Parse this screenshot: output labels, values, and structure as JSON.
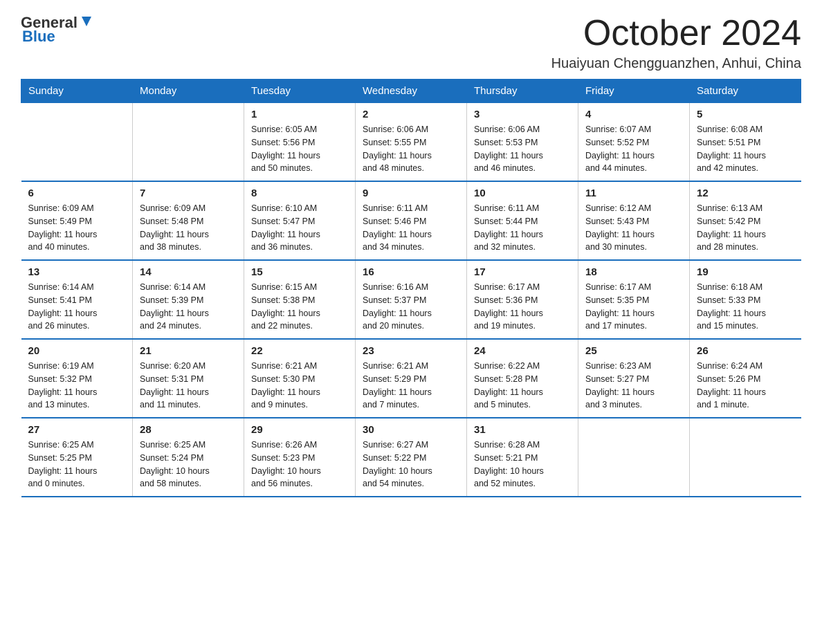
{
  "header": {
    "logo_general": "General",
    "logo_blue": "Blue",
    "month_title": "October 2024",
    "location": "Huaiyuan Chengguanzhen, Anhui, China"
  },
  "weekdays": [
    "Sunday",
    "Monday",
    "Tuesday",
    "Wednesday",
    "Thursday",
    "Friday",
    "Saturday"
  ],
  "weeks": [
    [
      {
        "day": "",
        "info": ""
      },
      {
        "day": "",
        "info": ""
      },
      {
        "day": "1",
        "info": "Sunrise: 6:05 AM\nSunset: 5:56 PM\nDaylight: 11 hours\nand 50 minutes."
      },
      {
        "day": "2",
        "info": "Sunrise: 6:06 AM\nSunset: 5:55 PM\nDaylight: 11 hours\nand 48 minutes."
      },
      {
        "day": "3",
        "info": "Sunrise: 6:06 AM\nSunset: 5:53 PM\nDaylight: 11 hours\nand 46 minutes."
      },
      {
        "day": "4",
        "info": "Sunrise: 6:07 AM\nSunset: 5:52 PM\nDaylight: 11 hours\nand 44 minutes."
      },
      {
        "day": "5",
        "info": "Sunrise: 6:08 AM\nSunset: 5:51 PM\nDaylight: 11 hours\nand 42 minutes."
      }
    ],
    [
      {
        "day": "6",
        "info": "Sunrise: 6:09 AM\nSunset: 5:49 PM\nDaylight: 11 hours\nand 40 minutes."
      },
      {
        "day": "7",
        "info": "Sunrise: 6:09 AM\nSunset: 5:48 PM\nDaylight: 11 hours\nand 38 minutes."
      },
      {
        "day": "8",
        "info": "Sunrise: 6:10 AM\nSunset: 5:47 PM\nDaylight: 11 hours\nand 36 minutes."
      },
      {
        "day": "9",
        "info": "Sunrise: 6:11 AM\nSunset: 5:46 PM\nDaylight: 11 hours\nand 34 minutes."
      },
      {
        "day": "10",
        "info": "Sunrise: 6:11 AM\nSunset: 5:44 PM\nDaylight: 11 hours\nand 32 minutes."
      },
      {
        "day": "11",
        "info": "Sunrise: 6:12 AM\nSunset: 5:43 PM\nDaylight: 11 hours\nand 30 minutes."
      },
      {
        "day": "12",
        "info": "Sunrise: 6:13 AM\nSunset: 5:42 PM\nDaylight: 11 hours\nand 28 minutes."
      }
    ],
    [
      {
        "day": "13",
        "info": "Sunrise: 6:14 AM\nSunset: 5:41 PM\nDaylight: 11 hours\nand 26 minutes."
      },
      {
        "day": "14",
        "info": "Sunrise: 6:14 AM\nSunset: 5:39 PM\nDaylight: 11 hours\nand 24 minutes."
      },
      {
        "day": "15",
        "info": "Sunrise: 6:15 AM\nSunset: 5:38 PM\nDaylight: 11 hours\nand 22 minutes."
      },
      {
        "day": "16",
        "info": "Sunrise: 6:16 AM\nSunset: 5:37 PM\nDaylight: 11 hours\nand 20 minutes."
      },
      {
        "day": "17",
        "info": "Sunrise: 6:17 AM\nSunset: 5:36 PM\nDaylight: 11 hours\nand 19 minutes."
      },
      {
        "day": "18",
        "info": "Sunrise: 6:17 AM\nSunset: 5:35 PM\nDaylight: 11 hours\nand 17 minutes."
      },
      {
        "day": "19",
        "info": "Sunrise: 6:18 AM\nSunset: 5:33 PM\nDaylight: 11 hours\nand 15 minutes."
      }
    ],
    [
      {
        "day": "20",
        "info": "Sunrise: 6:19 AM\nSunset: 5:32 PM\nDaylight: 11 hours\nand 13 minutes."
      },
      {
        "day": "21",
        "info": "Sunrise: 6:20 AM\nSunset: 5:31 PM\nDaylight: 11 hours\nand 11 minutes."
      },
      {
        "day": "22",
        "info": "Sunrise: 6:21 AM\nSunset: 5:30 PM\nDaylight: 11 hours\nand 9 minutes."
      },
      {
        "day": "23",
        "info": "Sunrise: 6:21 AM\nSunset: 5:29 PM\nDaylight: 11 hours\nand 7 minutes."
      },
      {
        "day": "24",
        "info": "Sunrise: 6:22 AM\nSunset: 5:28 PM\nDaylight: 11 hours\nand 5 minutes."
      },
      {
        "day": "25",
        "info": "Sunrise: 6:23 AM\nSunset: 5:27 PM\nDaylight: 11 hours\nand 3 minutes."
      },
      {
        "day": "26",
        "info": "Sunrise: 6:24 AM\nSunset: 5:26 PM\nDaylight: 11 hours\nand 1 minute."
      }
    ],
    [
      {
        "day": "27",
        "info": "Sunrise: 6:25 AM\nSunset: 5:25 PM\nDaylight: 11 hours\nand 0 minutes."
      },
      {
        "day": "28",
        "info": "Sunrise: 6:25 AM\nSunset: 5:24 PM\nDaylight: 10 hours\nand 58 minutes."
      },
      {
        "day": "29",
        "info": "Sunrise: 6:26 AM\nSunset: 5:23 PM\nDaylight: 10 hours\nand 56 minutes."
      },
      {
        "day": "30",
        "info": "Sunrise: 6:27 AM\nSunset: 5:22 PM\nDaylight: 10 hours\nand 54 minutes."
      },
      {
        "day": "31",
        "info": "Sunrise: 6:28 AM\nSunset: 5:21 PM\nDaylight: 10 hours\nand 52 minutes."
      },
      {
        "day": "",
        "info": ""
      },
      {
        "day": "",
        "info": ""
      }
    ]
  ]
}
